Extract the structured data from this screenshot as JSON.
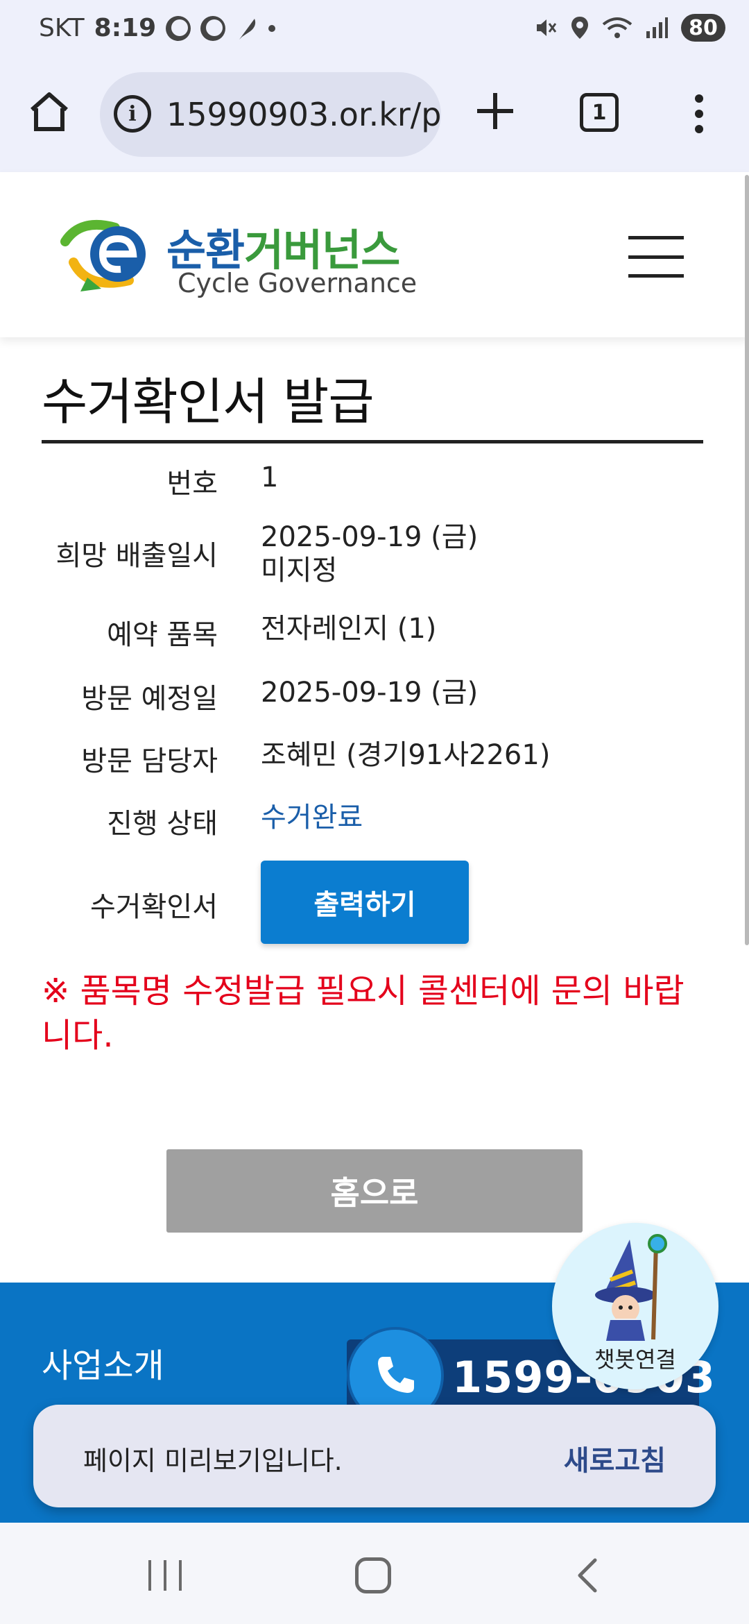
{
  "status_bar": {
    "carrier": "SKT",
    "time": "8:19",
    "battery": "80"
  },
  "browser": {
    "url": "15990903.or.kr/p",
    "tab_count": "1"
  },
  "site": {
    "logo_ko_blue": "순환",
    "logo_ko_green": "거버넌스",
    "logo_en": "Cycle Governance"
  },
  "page": {
    "title": "수거확인서 발급",
    "rows": [
      {
        "label": "번호",
        "value": "1"
      },
      {
        "label": "희망 배출일시",
        "value": "2025-09-19 (금)",
        "value2": "미지정"
      },
      {
        "label": "예약 품목",
        "value": "전자레인지 (1)"
      },
      {
        "label": "방문 예정일",
        "value": "2025-09-19 (금)"
      },
      {
        "label": "방문 담당자",
        "value": "조혜민 (경기91사2261)"
      },
      {
        "label": "진행 상태",
        "value": "수거완료"
      },
      {
        "label": "수거확인서",
        "button": "출력하기"
      }
    ],
    "notice": "※ 품목명 수정발급 필요시 콜센터에 문의 바랍니다.",
    "home_button": "홈으로"
  },
  "footer": {
    "title": "사업소개",
    "phone": "1599-0903"
  },
  "chatbot": {
    "label": "챗봇연결"
  },
  "toast": {
    "message": "페이지 미리보기입니다.",
    "action": "새로고침"
  },
  "colors": {
    "accent_blue": "#0b7dd0",
    "notice_red": "#e4001b",
    "status_blue": "#1a5ea9",
    "footer_blue": "#0a74c4"
  }
}
